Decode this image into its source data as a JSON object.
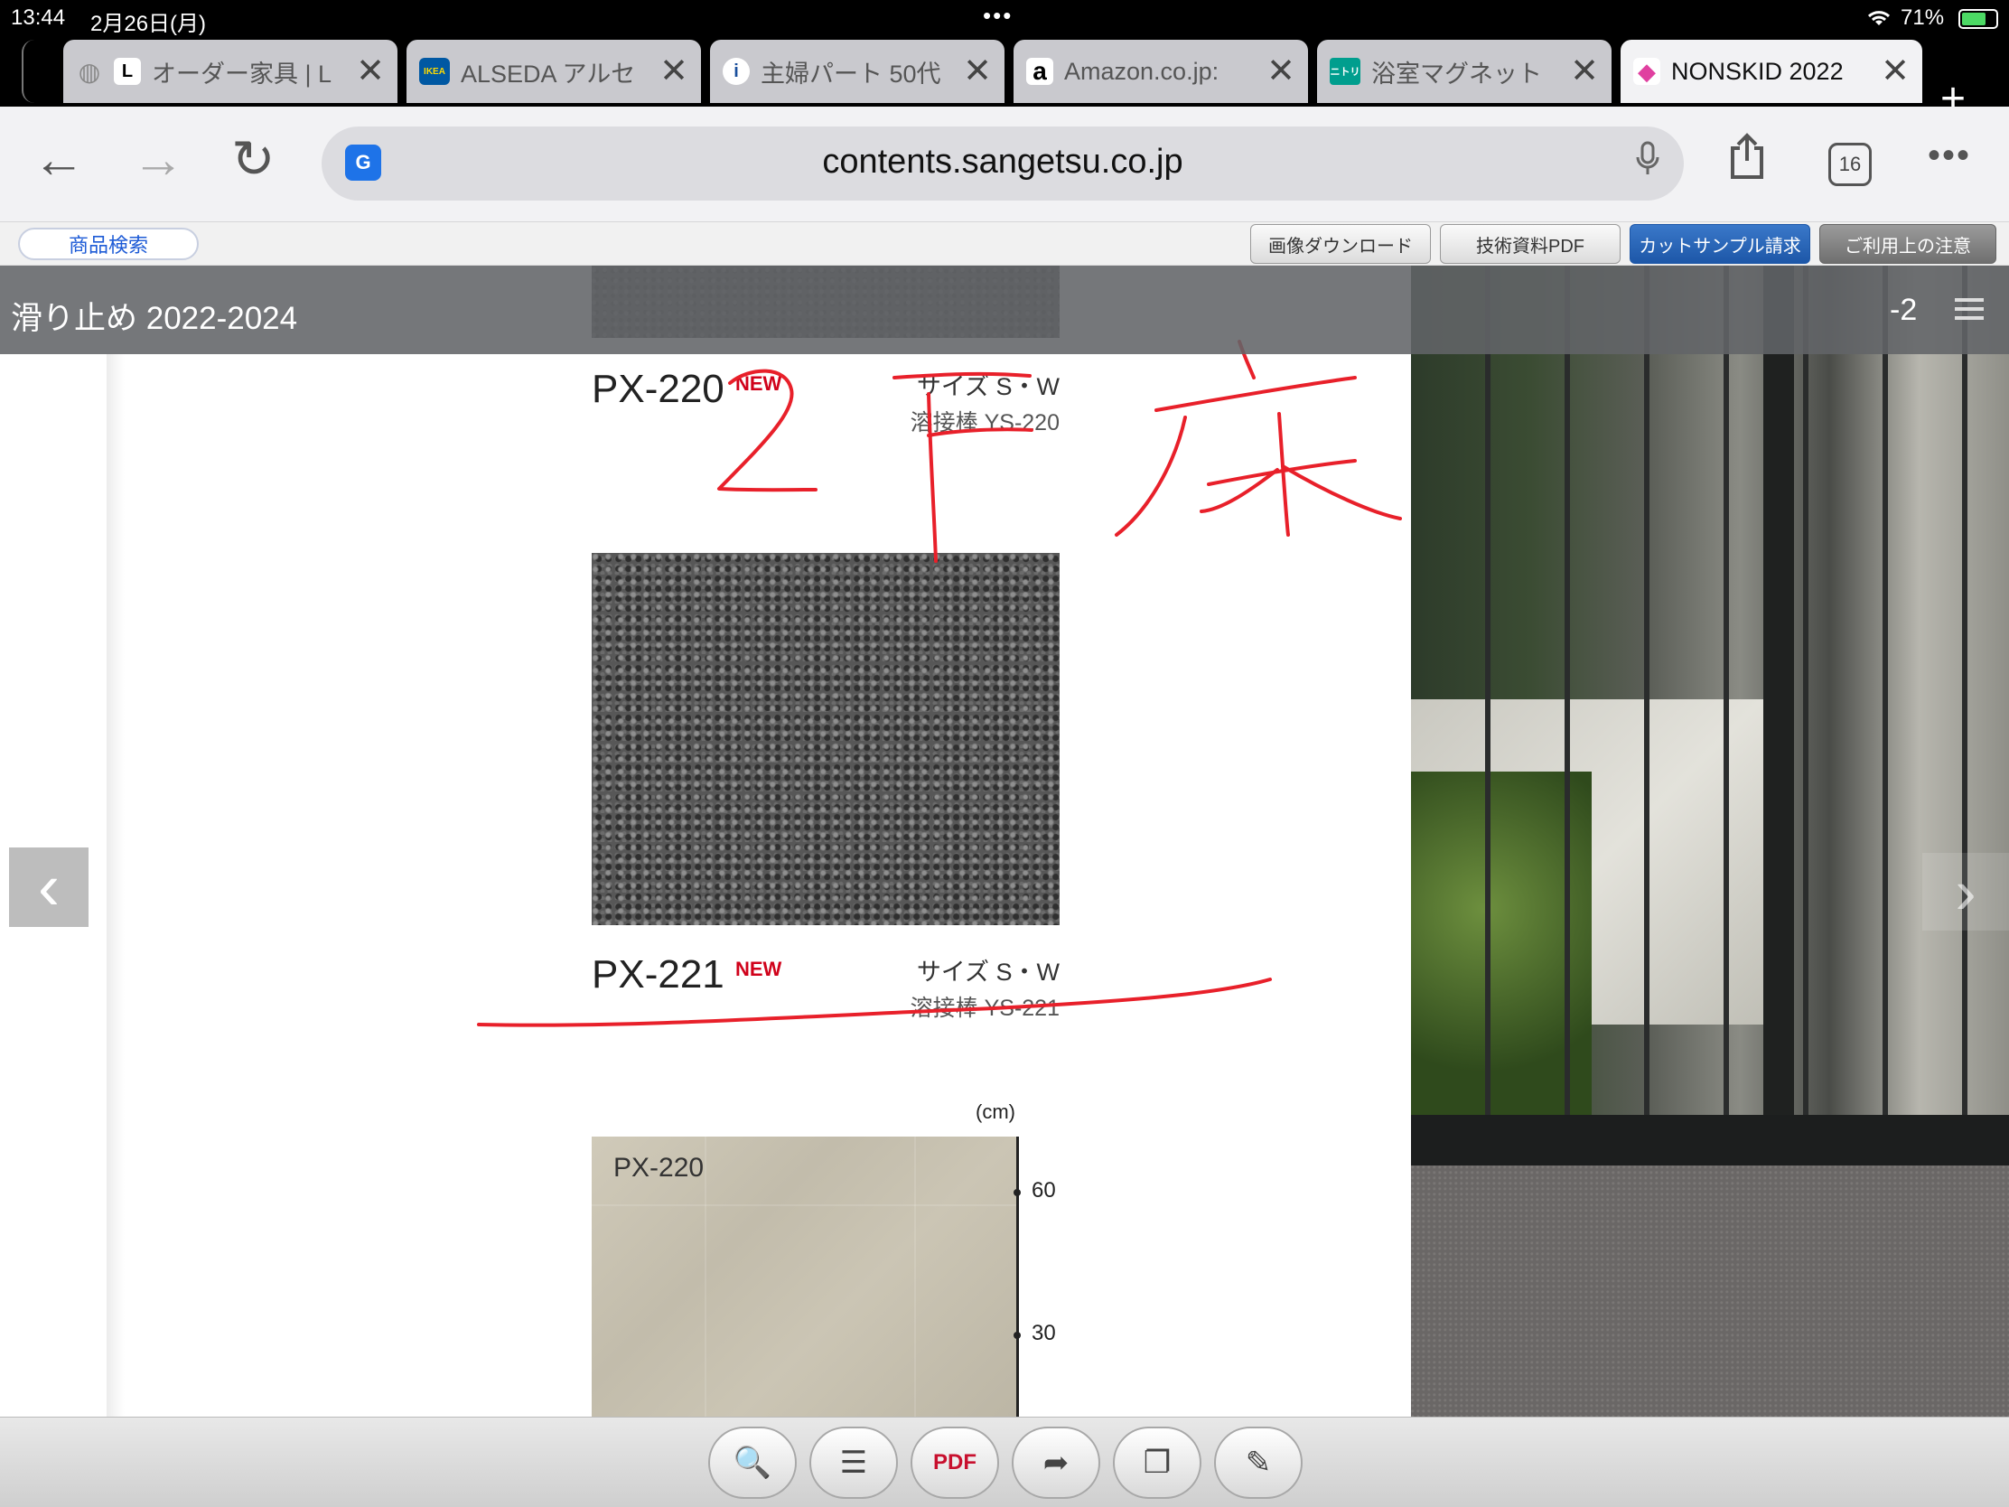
{
  "status": {
    "time": "13:44",
    "date": "2月26日(月)",
    "dots": "•••",
    "wifi_icon": "wifi-icon",
    "battery": "71%"
  },
  "tabs": [
    {
      "title": "オーダー家具 | L",
      "favicon": "L",
      "favicon_bg": "#ffffff",
      "favicon_color": "#000000"
    },
    {
      "title": "ALSEDA アルセ",
      "favicon": "IKEA",
      "favicon_bg": "#0058a3",
      "favicon_color": "#ffdb00"
    },
    {
      "title": "主婦パート 50代",
      "favicon": "i",
      "favicon_bg": "#ffffff",
      "favicon_color": "#1a4f9c"
    },
    {
      "title": "Amazon.co.jp:",
      "favicon": "a",
      "favicon_bg": "#ffffff",
      "favicon_color": "#000000"
    },
    {
      "title": "浴室マグネット",
      "favicon": "ニトリ",
      "favicon_bg": "#009e8e",
      "favicon_color": "#ffffff"
    },
    {
      "title": "NONSKID 2022",
      "favicon": "◆",
      "favicon_bg": "#ffffff",
      "favicon_color": "#e040a0"
    }
  ],
  "tab_close": "✕",
  "new_tab": "+",
  "toolbar": {
    "back": "←",
    "forward": "→",
    "reload": "↻",
    "translate": "G",
    "url": "contents.sangetsu.co.jp",
    "mic": "🎙",
    "share": "⇪",
    "tab_count": "16",
    "more": "•••"
  },
  "viewer": {
    "search_button": "商品検索",
    "buttons": [
      "画像ダウンロード",
      "技術資料PDF",
      "カットサンプル請求",
      "ご利用上の注意"
    ],
    "title": "滑り止め 2022-2024",
    "page": "-2",
    "prev": "‹",
    "next": "›"
  },
  "products": [
    {
      "code": "PX-220",
      "badge": "NEW",
      "size": "サイズ S・W",
      "weld": "溶接棒 YS-220"
    },
    {
      "code": "PX-221",
      "badge": "NEW",
      "size": "サイズ S・W",
      "weld": "溶接棒 YS-221"
    }
  ],
  "sample": {
    "label": "PX-220",
    "unit": "(cm)",
    "ticks": [
      "60",
      "30"
    ]
  },
  "bottom_tools": [
    {
      "name": "search-icon",
      "glyph": "🔍"
    },
    {
      "name": "list-icon",
      "glyph": "☰"
    },
    {
      "name": "pdf-icon",
      "glyph": "PDF"
    },
    {
      "name": "share-arrow-icon",
      "glyph": "➦"
    },
    {
      "name": "bookmark-icon",
      "glyph": "❐"
    },
    {
      "name": "pen-icon",
      "glyph": "✎"
    }
  ],
  "colors": {
    "accent_blue": "#1d57a8",
    "new_red": "#d0021b",
    "ink_red": "#e8202a"
  }
}
